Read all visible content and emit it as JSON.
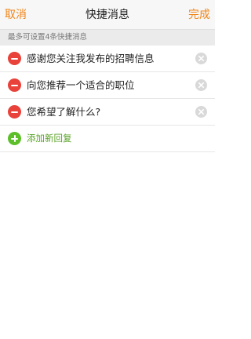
{
  "navbar": {
    "cancel_label": "取消",
    "title": "快捷消息",
    "done_label": "完成"
  },
  "section": {
    "header": "最多可设置4条快捷消息"
  },
  "messages": [
    {
      "text": "感谢您关注我发布的招聘信息"
    },
    {
      "text": "向您推荐一个适合的职位"
    },
    {
      "text": "您希望了解什么?"
    }
  ],
  "add_row": {
    "label": "添加新回复"
  },
  "colors": {
    "accent": "#f08519",
    "delete": "#e8423a",
    "add": "#5cbf2a"
  }
}
